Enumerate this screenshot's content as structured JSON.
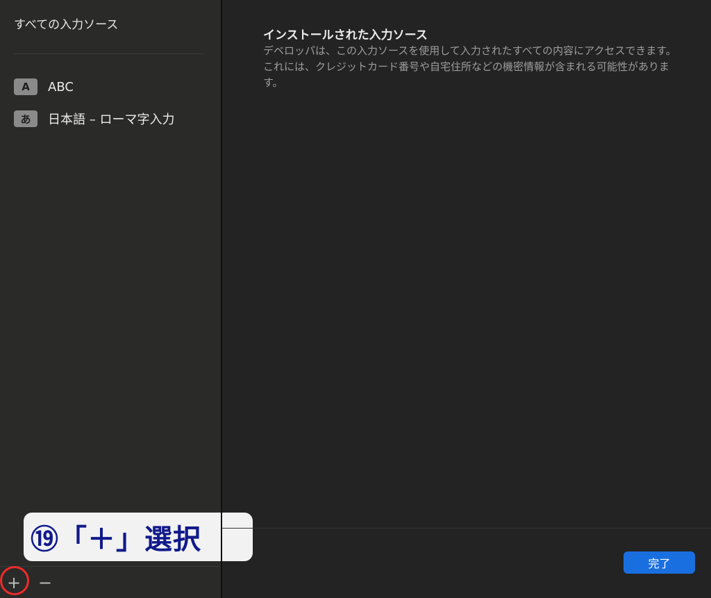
{
  "sidebar": {
    "title": "すべての入力ソース",
    "items": [
      {
        "badge": "A",
        "label": "ABC"
      },
      {
        "badge": "あ",
        "label": "日本語 – ローマ字入力"
      }
    ],
    "add_label": "+",
    "remove_label": "−"
  },
  "annotation": {
    "text": "⑲「＋」選択",
    "colors": {
      "text": "#101a8a",
      "background": "#f2f2f2",
      "circle": "#ee2a2a"
    }
  },
  "main": {
    "title": "インストールされた入力ソース",
    "description": "デベロッパは、この入力ソースを使用して入力されたすべての内容にアクセスできます。これには、クレジットカード番号や自宅住所などの機密情報が含まれる可能性があります。"
  },
  "footer": {
    "done_label": "完了"
  },
  "colors": {
    "accent": "#1a6fe0",
    "background": "#232323",
    "sidebar": "#2a2a28"
  }
}
